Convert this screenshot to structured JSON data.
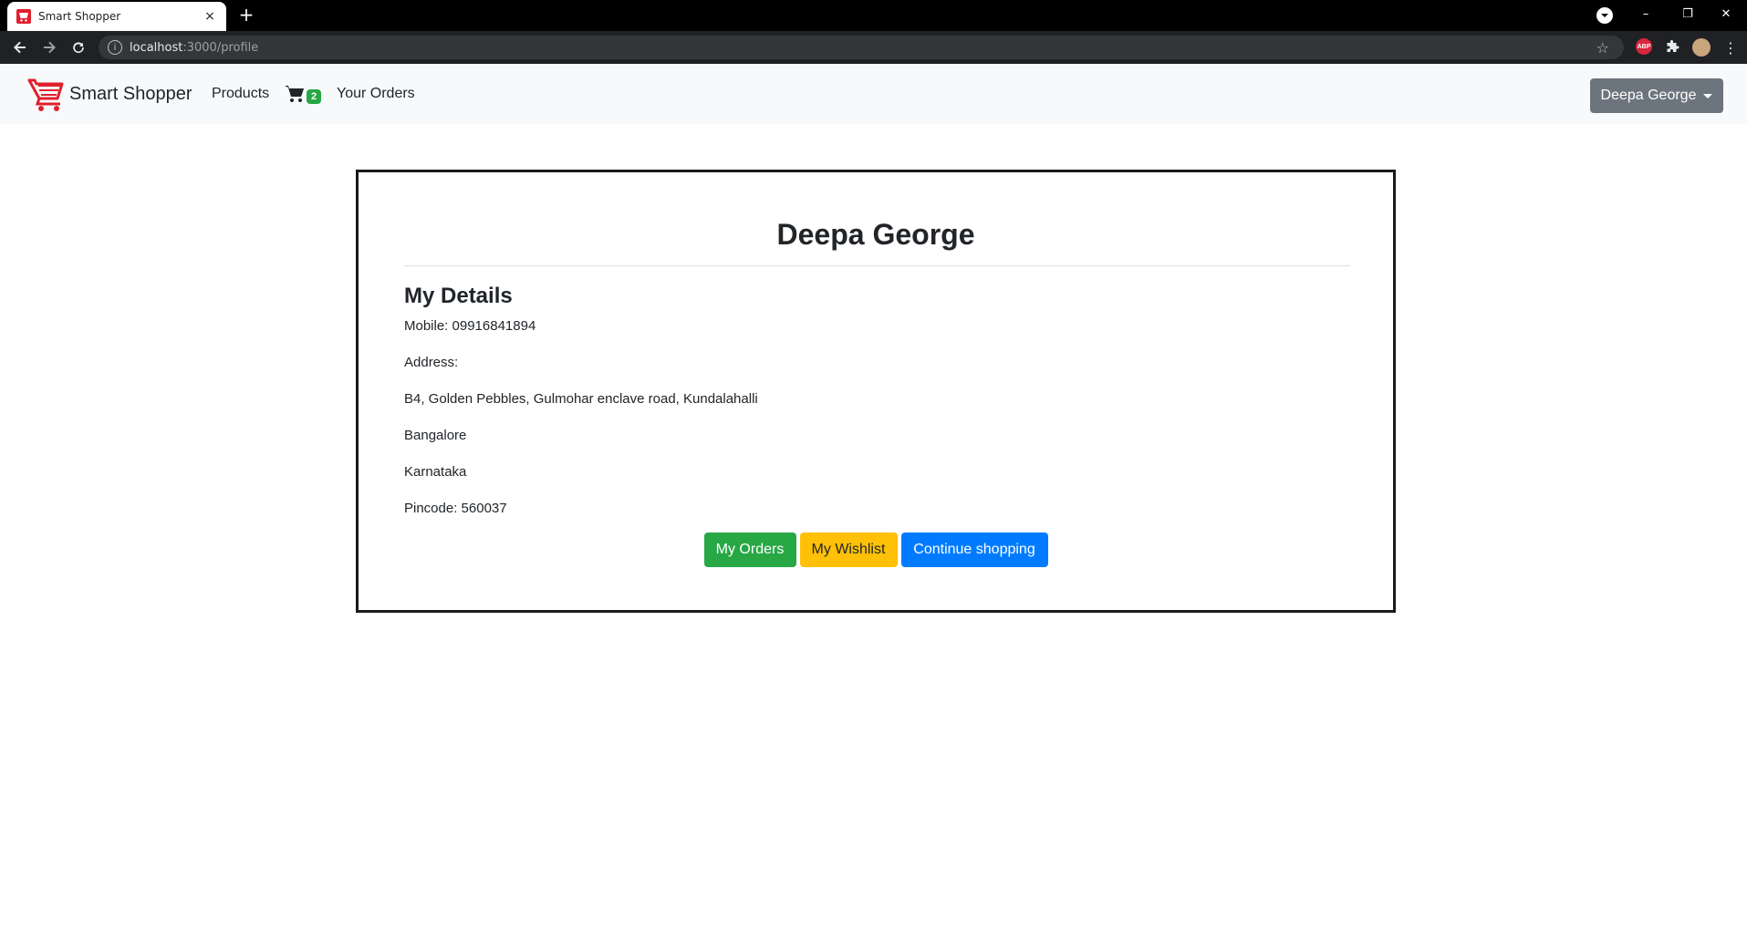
{
  "browser": {
    "tab_title": "Smart Shopper",
    "tab_close": "×",
    "new_tab": "+",
    "url_host": "localhost",
    "url_path": ":3000/profile",
    "window_controls": {
      "minimize": "–",
      "restore": "❐",
      "close": "✕"
    },
    "extensions": {
      "abp_label": "ABP"
    }
  },
  "navbar": {
    "brand": "Smart Shopper",
    "products": "Products",
    "cart_count": "2",
    "your_orders": "Your Orders",
    "user_menu": "Deepa George"
  },
  "profile": {
    "name": "Deepa George",
    "section_heading": "My Details",
    "mobile": "Mobile: 09916841894",
    "address_label": "Address:",
    "address_line": "B4, Golden Pebbles, Gulmohar enclave road, Kundalahalli",
    "city": "Bangalore",
    "state": "Karnataka",
    "pincode": "Pincode: 560037",
    "buttons": {
      "orders": "My Orders",
      "wishlist": "My Wishlist",
      "continue": "Continue shopping"
    }
  },
  "colors": {
    "green": "#28a745",
    "yellow": "#ffc107",
    "blue": "#007bff",
    "gray": "#6c757d",
    "navbar_bg": "#f8f9fa",
    "cart_logo_red": "#e0202e"
  }
}
